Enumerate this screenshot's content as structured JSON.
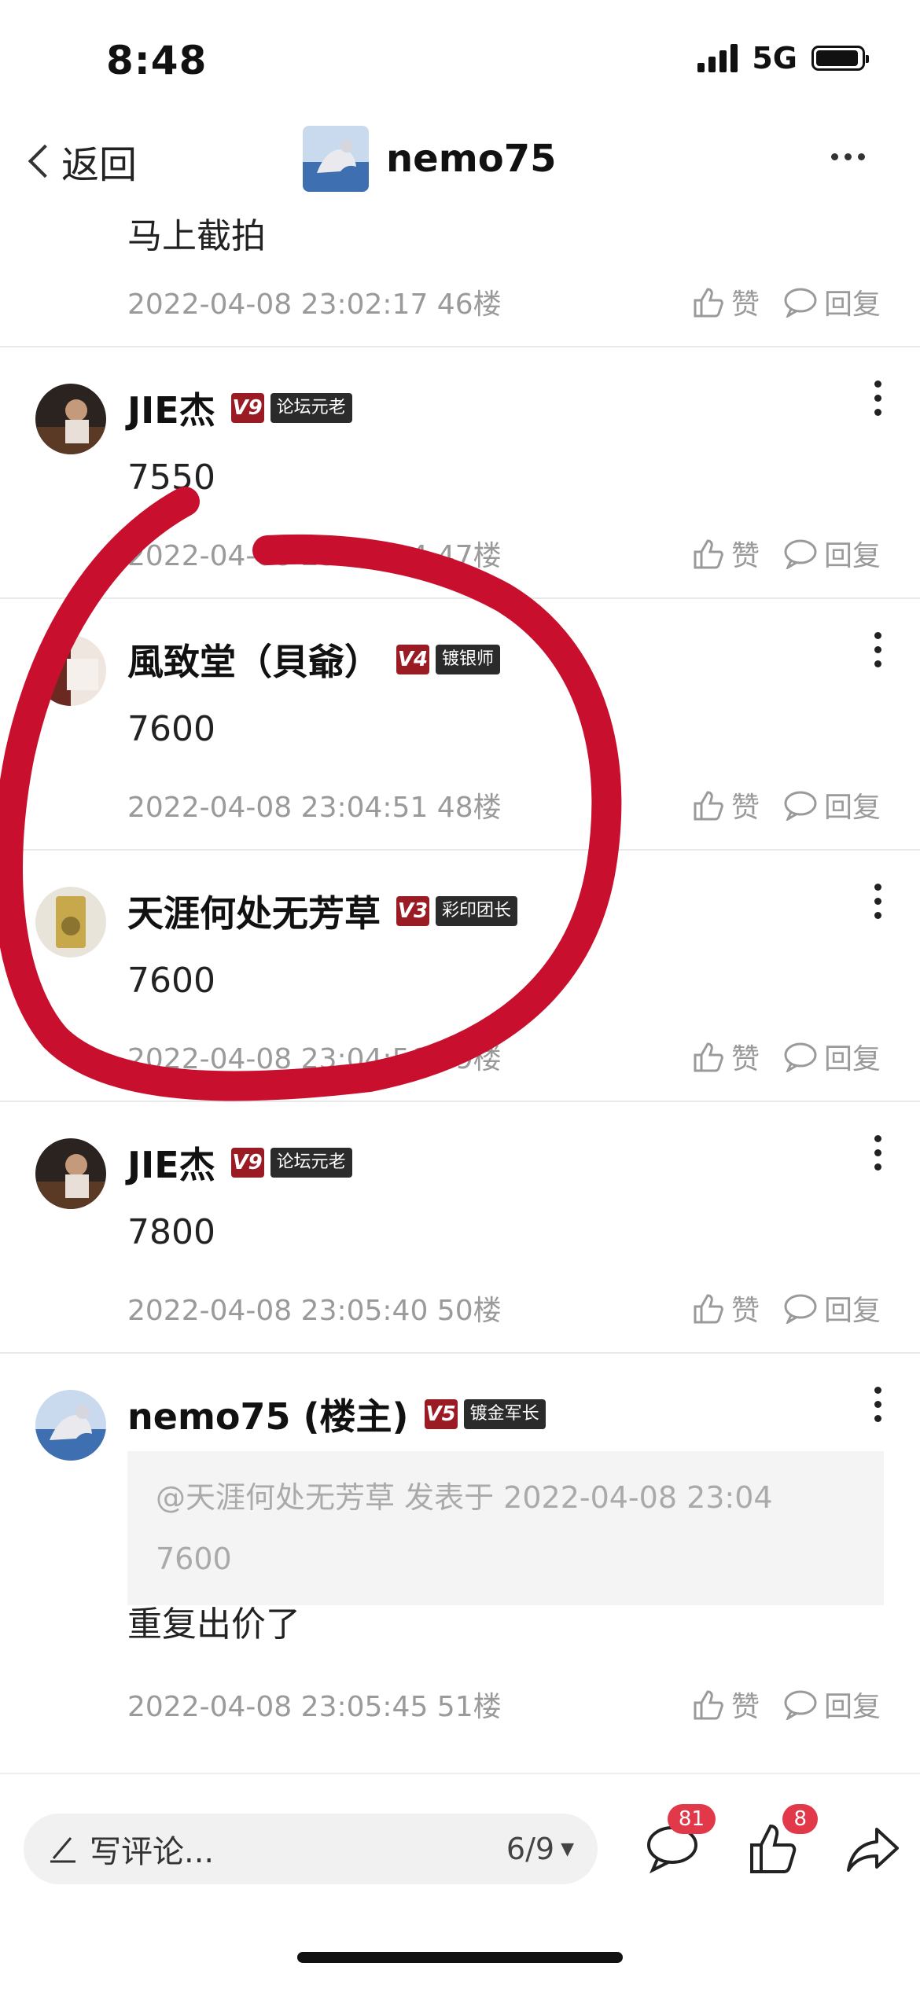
{
  "status": {
    "time": "8:48",
    "network": "5G"
  },
  "nav": {
    "back_label": "返回",
    "title": "nemo75"
  },
  "top_partial": {
    "content": "马上截拍",
    "meta": "2022-04-08 23:02:17  46楼"
  },
  "actions": {
    "like": "赞",
    "reply": "回复"
  },
  "posts": [
    {
      "name": "JIE杰",
      "level": "V9",
      "title": "论坛元老",
      "content": "7550",
      "meta": "2022-04-08 23:03:24  47楼"
    },
    {
      "name": "風致堂（貝爺）",
      "level": "V4",
      "title": "镀银师",
      "content": "7600",
      "meta": "2022-04-08 23:04:51  48楼"
    },
    {
      "name": "天涯何处无芳草",
      "level": "V3",
      "title": "彩印团长",
      "content": "7600",
      "meta": "2022-04-08 23:04:56  49楼"
    },
    {
      "name": "JIE杰",
      "level": "V9",
      "title": "论坛元老",
      "content": "7800",
      "meta": "2022-04-08 23:05:40  50楼"
    },
    {
      "name": "nemo75 (楼主)",
      "level": "V5",
      "title": "镀金军长",
      "quote_line1": "@天涯何处无芳草 发表于 2022-04-08 23:04",
      "quote_line2": "7600",
      "content": "重复出价了",
      "meta": "2022-04-08 23:05:45  51楼"
    }
  ],
  "bottom": {
    "placeholder": "写评论...",
    "page": "6/9",
    "comment_count": "81",
    "like_count": "8"
  },
  "colors": {
    "annotation": "#c8102e",
    "badge_level": "#9b1b24",
    "notify": "#e2394a"
  }
}
